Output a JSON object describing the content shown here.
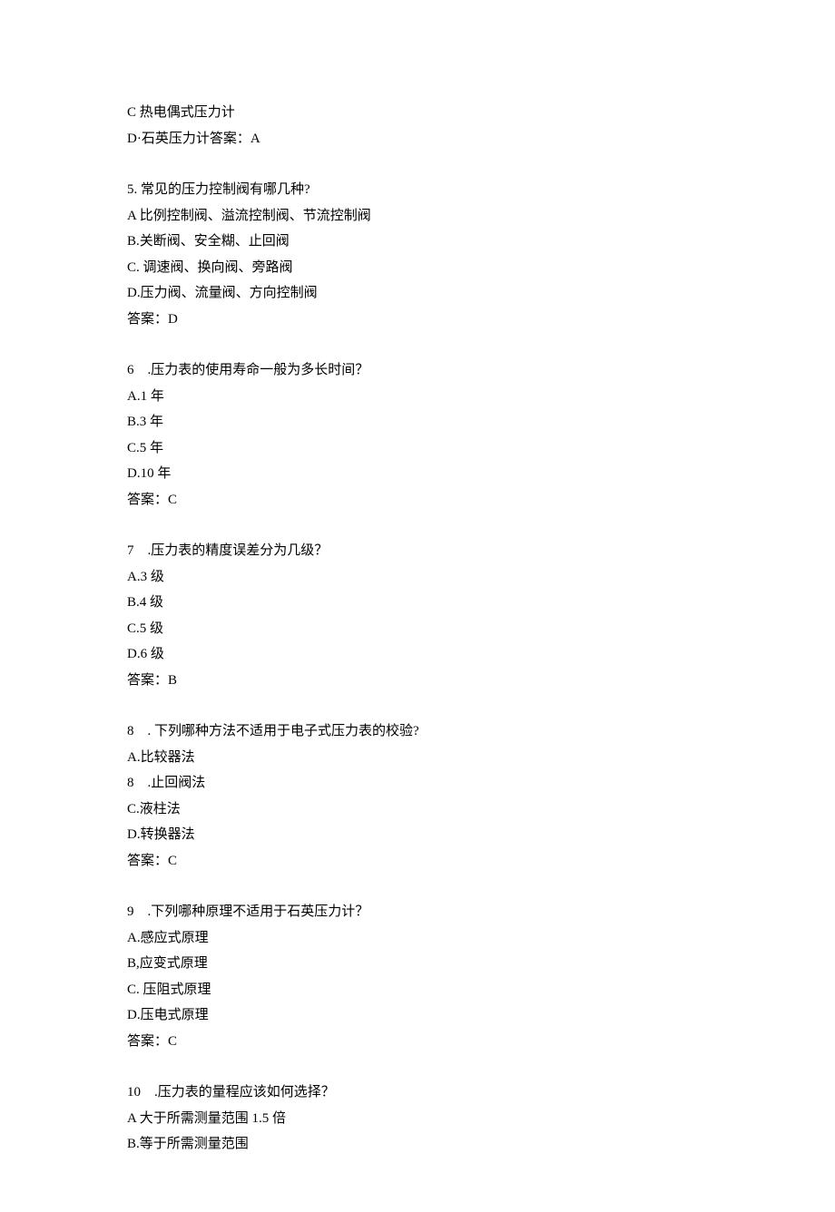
{
  "blocks": [
    {
      "lines": [
        "C 热电偶式压力计",
        "D·石英压力计答案：A"
      ]
    },
    {
      "lines": [
        "5. 常见的压力控制阀有哪几种?",
        "A 比例控制阀、溢流控制阀、节流控制阀",
        "B.关断阀、安全糊、止回阀",
        "C. 调速阀、换向阀、旁路阀",
        "D.压力阀、流量阀、方向控制阀",
        "答案：D"
      ]
    },
    {
      "lines": [
        "6    .压力表的使用寿命一般为多长时间？",
        "A.1 年",
        "B.3 年",
        "C.5 年",
        "D.10 年",
        "答案：C"
      ]
    },
    {
      "lines": [
        "7    .压力表的精度误差分为几级？",
        "A.3 级",
        "B.4 级",
        "C.5 级",
        "D.6 级",
        "答案：B"
      ]
    },
    {
      "lines": [
        "8    . 下列哪种方法不适用于电子式压力表的校验?",
        "A.比较器法",
        "8    .止回阀法",
        "C.液柱法",
        "D.转换器法",
        "答案：C"
      ]
    },
    {
      "lines": [
        "9    .下列哪种原理不适用于石英压力计？",
        "A.感应式原理",
        "B,应变式原理",
        "C. 压阻式原理",
        "D.压电式原理",
        "答案：C"
      ]
    },
    {
      "lines": [
        "10    .压力表的量程应该如何选择？",
        "A 大于所需测量范围 1.5 倍",
        "B.等于所需测量范围"
      ]
    }
  ]
}
